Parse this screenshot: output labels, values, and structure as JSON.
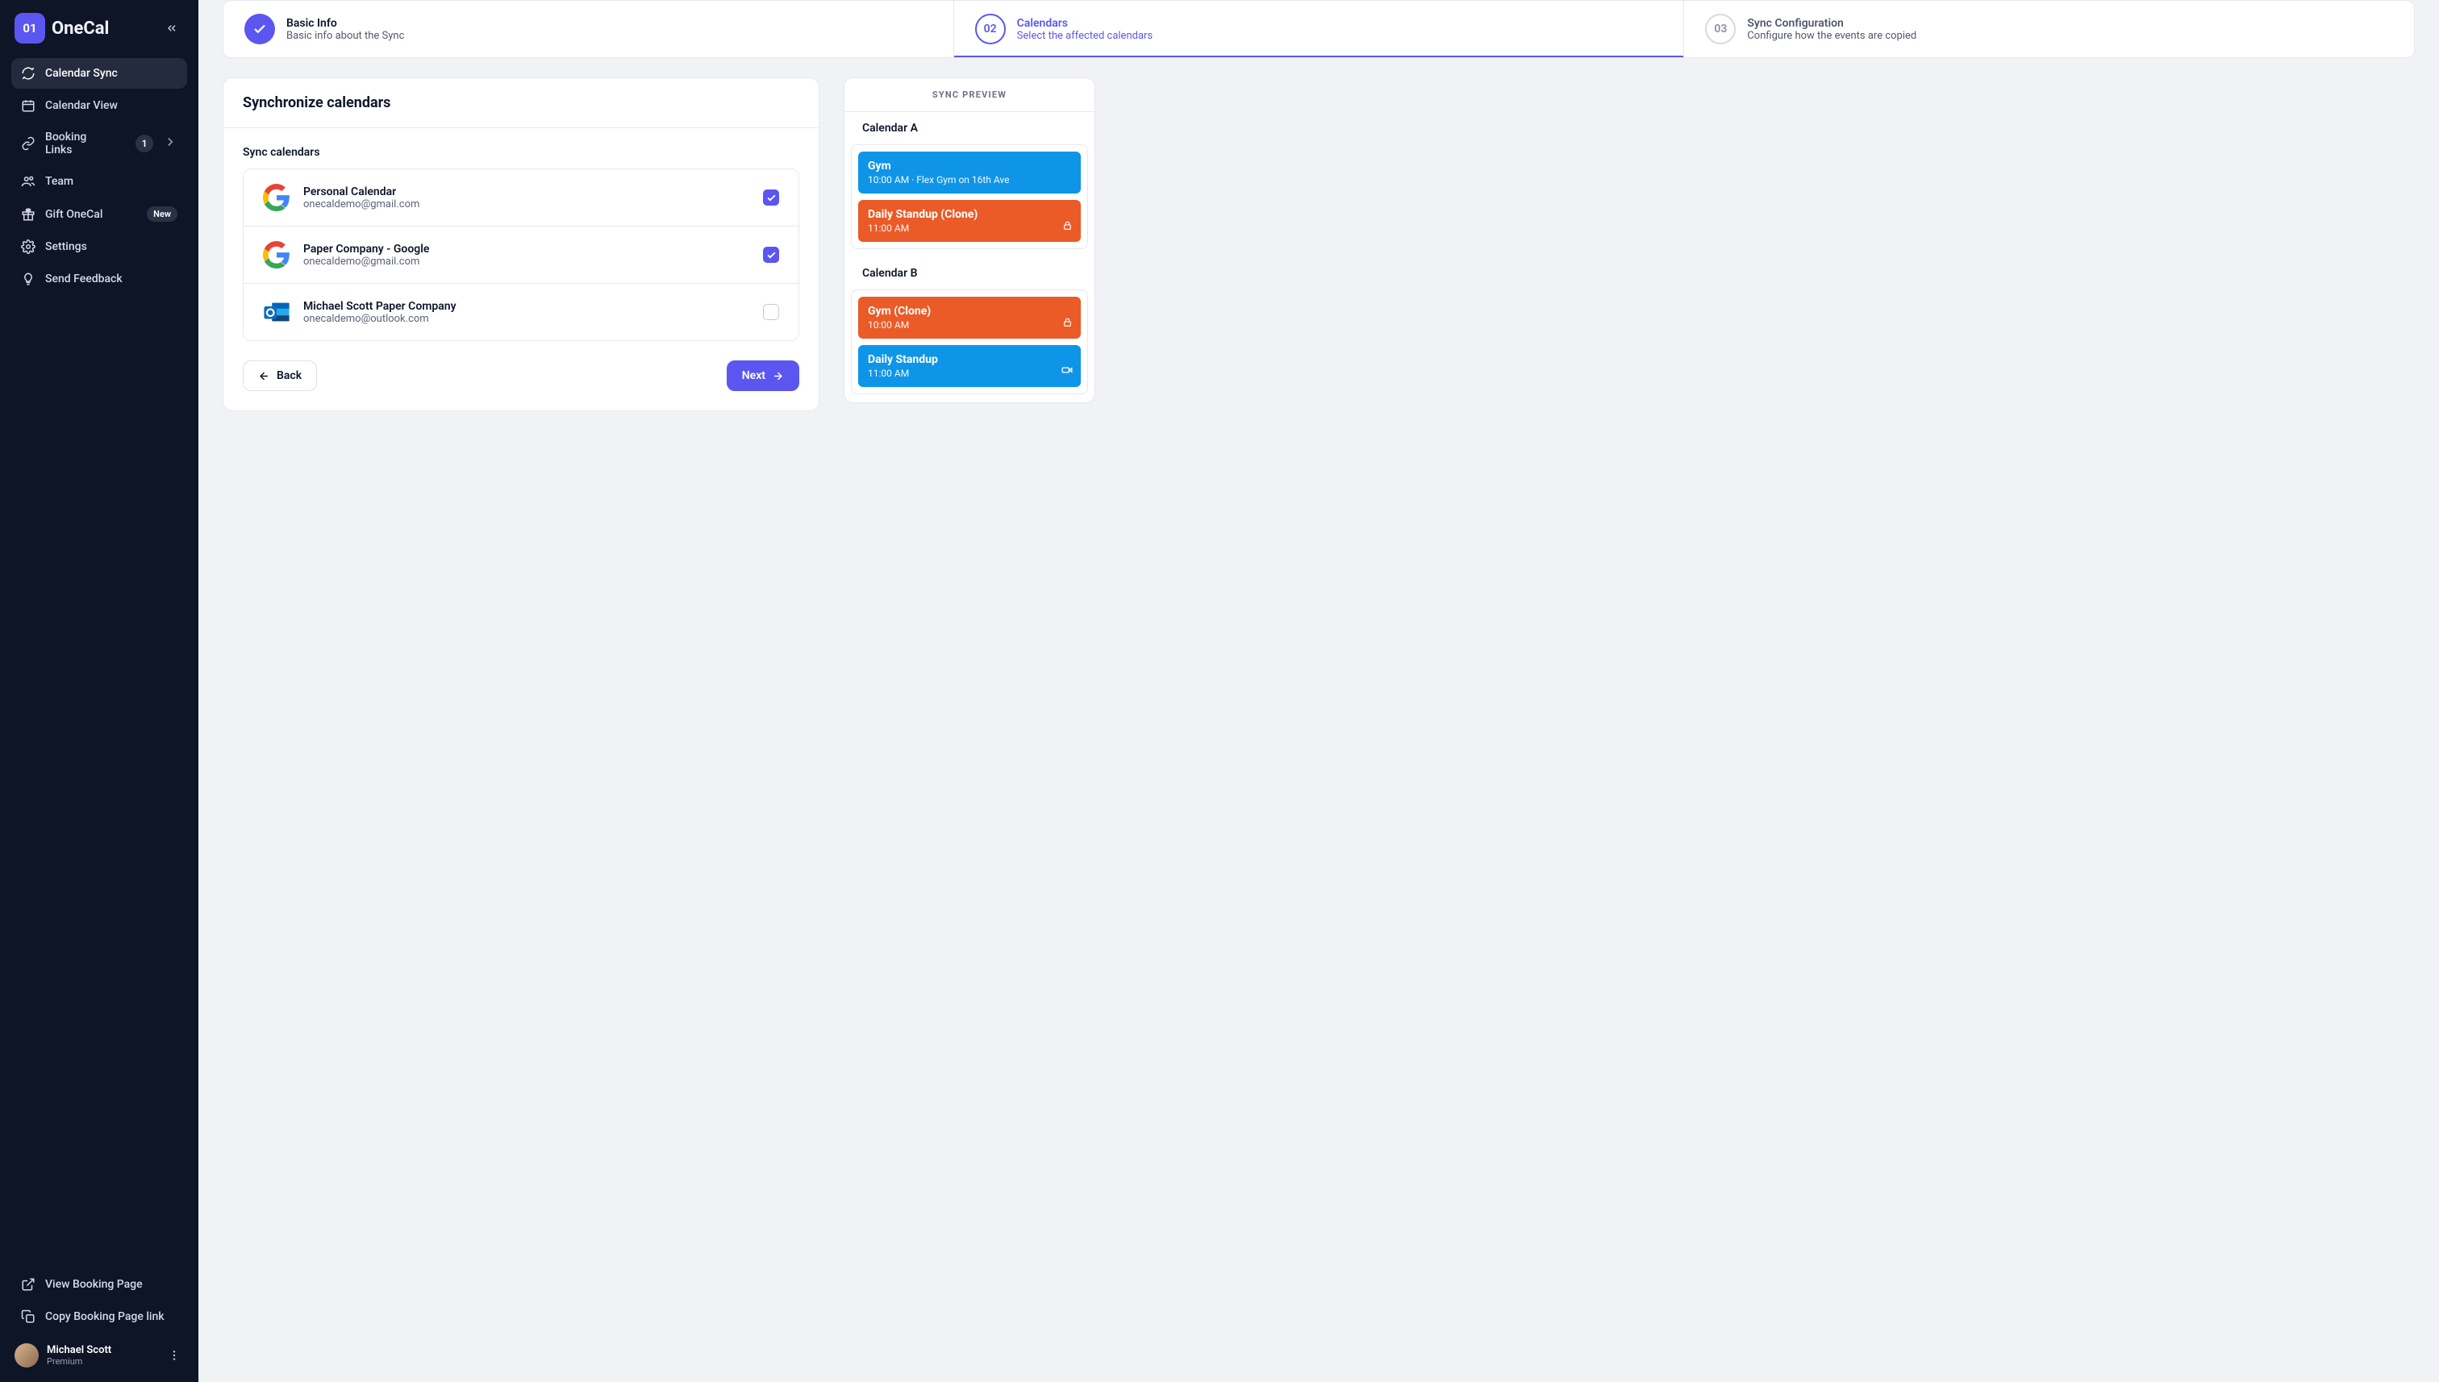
{
  "brand": {
    "logo_abbr": "01",
    "name": "OneCal"
  },
  "sidebar": {
    "items": [
      {
        "label": "Calendar Sync"
      },
      {
        "label": "Calendar View"
      },
      {
        "label": "Booking Links",
        "badge_count": "1"
      },
      {
        "label": "Team"
      },
      {
        "label": "Gift OneCal",
        "badge_new": "New"
      },
      {
        "label": "Settings"
      },
      {
        "label": "Send Feedback"
      }
    ],
    "bottom": [
      {
        "label": "View Booking Page"
      },
      {
        "label": "Copy Booking Page link"
      }
    ]
  },
  "profile": {
    "name": "Michael Scott",
    "plan": "Premium"
  },
  "stepper": {
    "steps": [
      {
        "title": "Basic Info",
        "sub": "Basic info about the Sync"
      },
      {
        "num": "02",
        "title": "Calendars",
        "sub": "Select the affected calendars"
      },
      {
        "num": "03",
        "title": "Sync Configuration",
        "sub": "Configure how the events are copied"
      }
    ]
  },
  "sync": {
    "heading": "Synchronize calendars",
    "list_label": "Sync calendars",
    "calendars": [
      {
        "name": "Personal Calendar",
        "email": "onecaldemo@gmail.com",
        "provider": "google",
        "checked": true
      },
      {
        "name": "Paper Company - Google",
        "email": "onecaldemo@gmail.com",
        "provider": "google",
        "checked": true
      },
      {
        "name": "Michael Scott Paper Company",
        "email": "onecaldemo@outlook.com",
        "provider": "outlook",
        "checked": false
      }
    ]
  },
  "buttons": {
    "back": "Back",
    "next": "Next"
  },
  "preview": {
    "header": "SYNC PREVIEW",
    "sections": [
      {
        "label": "Calendar A",
        "events": [
          {
            "title": "Gym",
            "sub": "10:00 AM · Flex Gym on 16th Ave",
            "color": "blue",
            "icon": ""
          },
          {
            "title": "Daily Standup (Clone)",
            "sub": "11:00 AM",
            "color": "orange",
            "icon": "lock"
          }
        ]
      },
      {
        "label": "Calendar B",
        "events": [
          {
            "title": "Gym (Clone)",
            "sub": "10:00 AM",
            "color": "orange",
            "icon": "lock"
          },
          {
            "title": "Daily Standup",
            "sub": "11:00 AM",
            "color": "blue",
            "icon": "camera"
          }
        ]
      }
    ]
  }
}
